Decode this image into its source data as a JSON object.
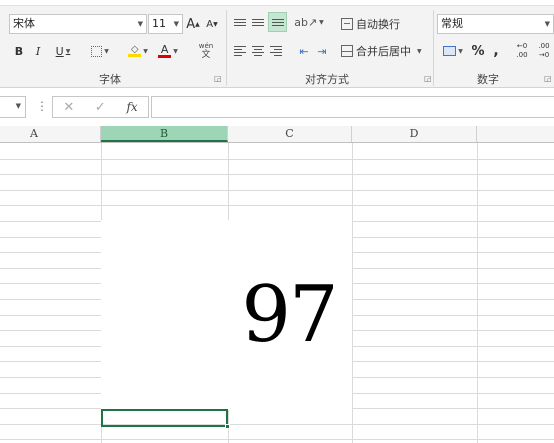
{
  "ribbon": {
    "font": {
      "font_name": "宋体",
      "font_size": "11",
      "grow_label": "A",
      "shrink_label": "A",
      "bold": "B",
      "italic": "I",
      "underline": "U",
      "font_color_label": "A",
      "phonetic_top": "wén",
      "phonetic_bottom": "文",
      "group_label": "字体"
    },
    "alignment": {
      "wrap_text": "自动换行",
      "merge_center": "合并后居中",
      "group_label": "对齐方式"
    },
    "number": {
      "format": "常规",
      "percent": "%",
      "comma": ",",
      "inc_decimal_top": "←0",
      "inc_decimal_bottom": ".00",
      "dec_decimal_top": ".00",
      "dec_decimal_bottom": "→0",
      "group_label": "数字"
    },
    "colors": {
      "accent": "#217346",
      "fill_yellow": "#ffd800",
      "font_red": "#e00000"
    }
  },
  "formula_bar": {
    "cancel": "✕",
    "enter": "✓",
    "fx": "fx",
    "value": ""
  },
  "columns": [
    "A",
    "B",
    "C",
    "D"
  ],
  "active_column": "B",
  "content": {
    "number": "97"
  }
}
